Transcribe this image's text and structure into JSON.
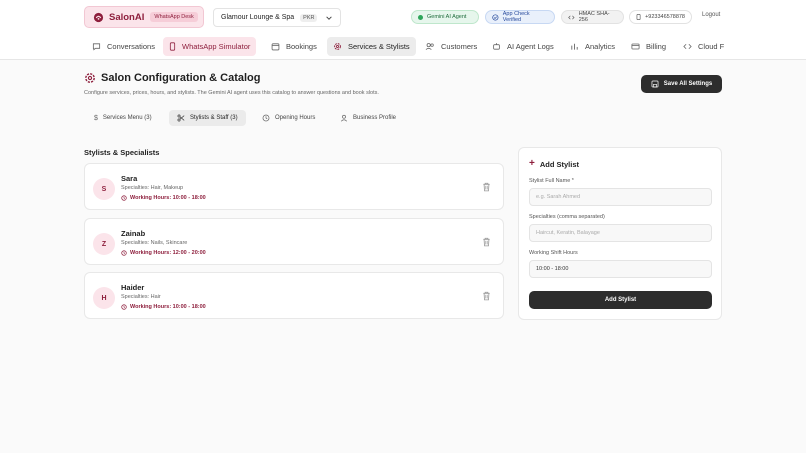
{
  "header": {
    "brand_name": "SalonAI",
    "brand_badge": "WhatsApp Desk",
    "salon_name": "Glamour Lounge & Spa",
    "currency": "PKR",
    "gemini_label": "Gemini AI Agent",
    "appcheck_label": "App Check Verified",
    "hmac_label": "HMAC SHA-256",
    "phone": "+923346578878",
    "logout_label": "Logout"
  },
  "nav": {
    "conversations": "Conversations",
    "whatsapp": "WhatsApp Simulator",
    "bookings": "Bookings",
    "services": "Services & Stylists",
    "customers": "Customers",
    "ai_logs": "AI Agent Logs",
    "analytics": "Analytics",
    "billing": "Billing",
    "cloud": "Cloud F"
  },
  "page": {
    "title": "Salon Configuration & Catalog",
    "subtitle": "Configure services, prices, hours, and stylists. The Gemini AI agent uses this catalog to answer questions and book slots.",
    "save_label": "Save All Settings"
  },
  "subtabs": {
    "services": "Services Menu (3)",
    "stylists": "Stylists & Staff (3)",
    "hours": "Opening Hours",
    "profile": "Business Profile"
  },
  "stylists": {
    "section_title": "Stylists & Specialists",
    "items": [
      {
        "initial": "S",
        "name": "Sara",
        "specialties": "Specialties: Hair, Makeup",
        "hours": "Working Hours: 10:00 - 18:00"
      },
      {
        "initial": "Z",
        "name": "Zainab",
        "specialties": "Specialties: Nails, Skincare",
        "hours": "Working Hours: 12:00 - 20:00"
      },
      {
        "initial": "H",
        "name": "Haider",
        "specialties": "Specialties: Hair",
        "hours": "Working Hours: 10:00 - 18:00"
      }
    ]
  },
  "form": {
    "title": "Add Stylist",
    "name_label": "Stylist Full Name *",
    "name_placeholder": "e.g. Sarah Ahmed",
    "specialties_label": "Specialties (comma separated)",
    "specialties_placeholder": "Haircut, Keratin, Balayage",
    "shift_label": "Working Shift Hours",
    "shift_value": "10:00 - 18:00",
    "submit_label": "Add Stylist"
  },
  "colors": {
    "brand": "#8e1f3d",
    "brand_light": "#fbe4ea",
    "dark_button": "#2d2d2d"
  },
  "icons": {
    "brand": "salon-logo-icon",
    "chevron": "chevron-down-icon",
    "clock": "clock-icon",
    "trash": "trash-icon"
  }
}
